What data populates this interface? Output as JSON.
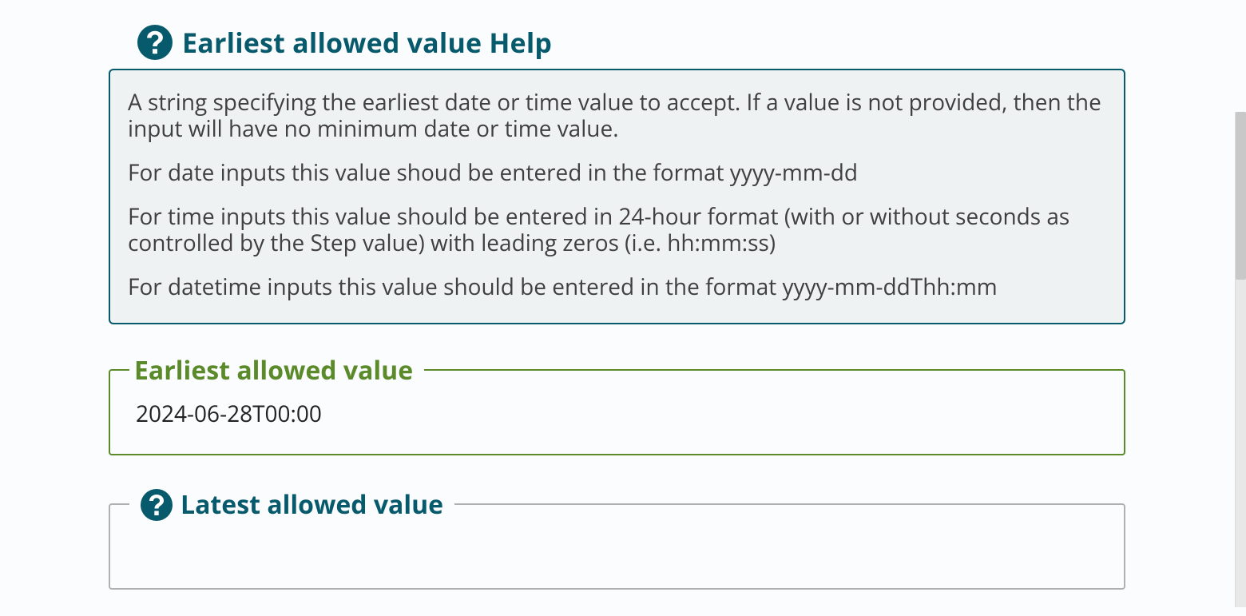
{
  "help": {
    "title": "Earliest allowed value Help",
    "paragraphs": [
      "A string specifying the earliest date or time value to accept. If a value is not provided, then the input will have no minimum date or time value.",
      "For date inputs this value shoud be entered in the format yyyy-mm-dd",
      "For time inputs this value should be entered in 24-hour format (with or without seconds as controlled by the Step value) with leading zeros (i.e. hh:mm:ss)",
      "For datetime inputs this value should be entered in the format yyyy-mm-ddThh:mm"
    ]
  },
  "fields": {
    "earliest": {
      "label": "Earliest allowed value",
      "value": "2024-06-28T00:00"
    },
    "latest": {
      "label": "Latest allowed value",
      "value": ""
    }
  }
}
